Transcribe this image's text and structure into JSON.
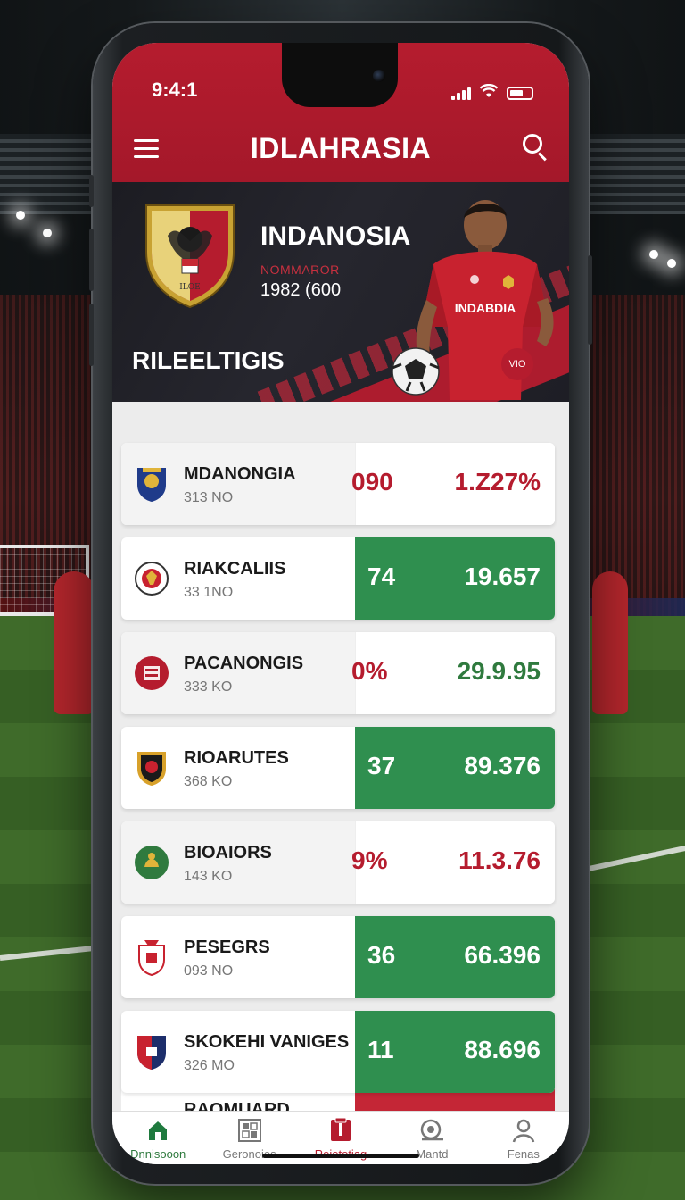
{
  "status_bar": {
    "time": "9:4:1"
  },
  "header": {
    "title": "IDLAHRASIA"
  },
  "hero": {
    "team_name": "INDANOSIA",
    "team_label": "NOMMAROR",
    "team_years": "1982 (600",
    "caption": "RILEELTIGIS",
    "jersey_text": "INDABDIA",
    "corner_badge": "VIO"
  },
  "rows": [
    {
      "name": "MDANONGIA",
      "sub": "313 NO",
      "stat": "090",
      "value": "1.Z27%",
      "style": "white",
      "value_color": "red"
    },
    {
      "name": "RIAKCALIIS",
      "sub": "33 1NO",
      "stat": "74",
      "value": "19.657",
      "style": "green"
    },
    {
      "name": "PACANONGIS",
      "sub": "333 KO",
      "stat": "0%",
      "value": "29.9.95",
      "style": "white",
      "value_color": "green"
    },
    {
      "name": "RIOARUTES",
      "sub": "368 KO",
      "stat": "37",
      "value": "89.376",
      "style": "green"
    },
    {
      "name": "BIOAIORS",
      "sub": "143 KO",
      "stat": "9%",
      "value": "11.3.76",
      "style": "white",
      "value_color": "red"
    },
    {
      "name": "PESEGRS",
      "sub": "093 NO",
      "stat": "36",
      "value": "66.396",
      "style": "green"
    },
    {
      "name": "SKOKEHI VANIGES",
      "sub": "326 MO",
      "stat": "11",
      "value": "88.696",
      "style": "green"
    }
  ],
  "peek_row": {
    "name": "RAOMUARD"
  },
  "bottom_nav": [
    {
      "label": "Dnnisooon",
      "icon": "home-icon"
    },
    {
      "label": "Geronoies",
      "icon": "grid-icon"
    },
    {
      "label": "Reietetiag",
      "icon": "document-icon"
    },
    {
      "label": "Mantd",
      "icon": "magnifier-icon"
    },
    {
      "label": "Fenas",
      "icon": "profile-icon"
    }
  ],
  "colors": {
    "brand_red": "#b51c2e",
    "accent_green": "#2f8f4f"
  }
}
